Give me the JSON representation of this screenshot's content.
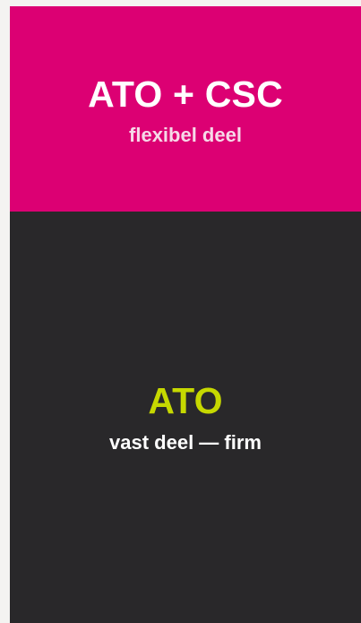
{
  "top_block": {
    "title": "ATO + CSC",
    "subtitle": "flexibel deel",
    "background_color": "#dc0073",
    "text_color": "#ffffff"
  },
  "bottom_block": {
    "title": "ATO",
    "subtitle": "vast deel — firm",
    "background_color": "#29282a",
    "title_color": "#c6d800",
    "subtitle_color": "#ffffff"
  }
}
